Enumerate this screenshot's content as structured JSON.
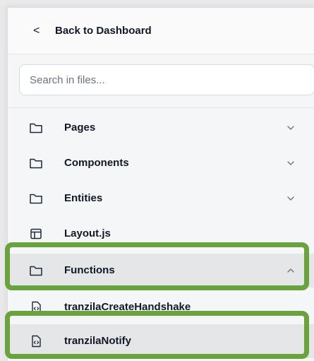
{
  "header": {
    "back_chevron": "<",
    "back_label": "Back to Dashboard"
  },
  "search": {
    "placeholder": "Search in files...",
    "value": ""
  },
  "tree": {
    "items": [
      {
        "label": "Pages",
        "icon": "folder-icon",
        "expanded": false
      },
      {
        "label": "Components",
        "icon": "folder-icon",
        "expanded": false
      },
      {
        "label": "Entities",
        "icon": "folder-icon",
        "expanded": false
      },
      {
        "label": "Layout.js",
        "icon": "layout-file-icon"
      },
      {
        "label": "Functions",
        "icon": "folder-icon",
        "expanded": true,
        "selected": true
      },
      {
        "label": "tranzilaCreateHandshake",
        "icon": "code-file-icon"
      },
      {
        "label": "tranzilaNotify",
        "icon": "code-file-icon",
        "selected": true
      }
    ]
  },
  "colors": {
    "highlight_outline": "#6aa33d",
    "selected_row": "#e5e6e8",
    "panel_bg": "#f5f6f7"
  }
}
